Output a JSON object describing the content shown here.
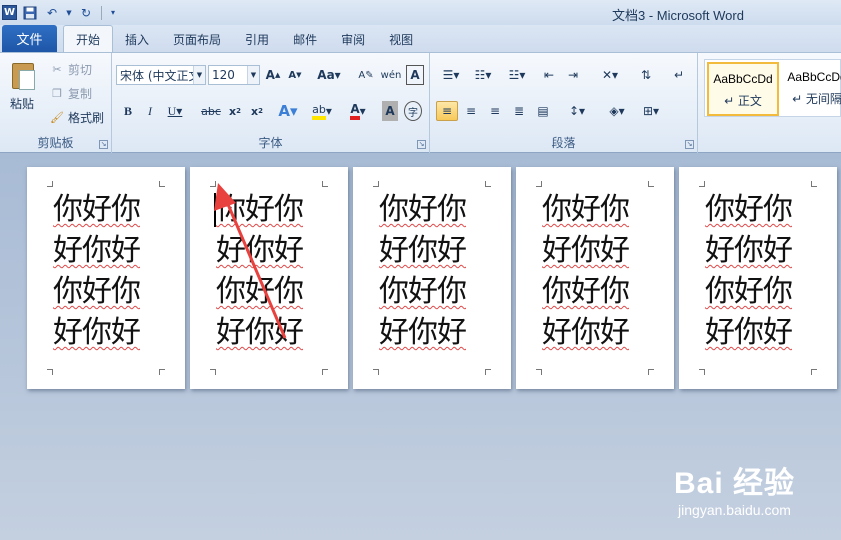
{
  "window": {
    "title": "文档3 - Microsoft Word"
  },
  "qat": {
    "app_icon_letter": "W"
  },
  "tabs": [
    {
      "label": "文件",
      "active": false
    },
    {
      "label": "开始",
      "active": true
    },
    {
      "label": "插入",
      "active": false
    },
    {
      "label": "页面布局",
      "active": false
    },
    {
      "label": "引用",
      "active": false
    },
    {
      "label": "邮件",
      "active": false
    },
    {
      "label": "审阅",
      "active": false
    },
    {
      "label": "视图",
      "active": false
    }
  ],
  "clipboard": {
    "group_label": "剪贴板",
    "paste": "粘贴",
    "cut": "剪切",
    "copy": "复制",
    "format_painter": "格式刷"
  },
  "font": {
    "group_label": "字体",
    "font_name": "宋体 (中文正文)",
    "font_size": "120"
  },
  "paragraph": {
    "group_label": "段落"
  },
  "styles": [
    {
      "sample": "AaBbCcDd",
      "name": "↵ 正文",
      "selected": true
    },
    {
      "sample": "AaBbCcDd",
      "name": "↵ 无间隔",
      "selected": false
    }
  ],
  "pages": [
    {
      "lines": [
        "你好你",
        "好你好",
        "你好你",
        "好你好"
      ],
      "has_cursor": false
    },
    {
      "lines": [
        "你好你",
        "好你好",
        "你好你",
        "好你好"
      ],
      "has_cursor": true
    },
    {
      "lines": [
        "你好你",
        "好你好",
        "你好你",
        "好你好"
      ],
      "has_cursor": false
    },
    {
      "lines": [
        "你好你",
        "好你好",
        "你好你",
        "好你好"
      ],
      "has_cursor": false
    },
    {
      "lines": [
        "你好你",
        "好你好",
        "你好你",
        "好你好"
      ],
      "has_cursor": false
    }
  ],
  "watermark": {
    "logo": "Bai 经验",
    "url": "jingyan.baidu.com"
  },
  "colors": {
    "file_tab": "#1e56a8",
    "arrow": "#e8413e",
    "highlight": "#f7c95a"
  }
}
